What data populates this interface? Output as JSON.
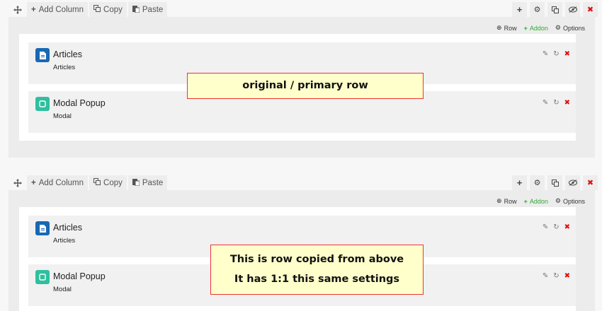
{
  "toolbar": {
    "add_column_label": "Add Column",
    "copy_label": "Copy",
    "paste_label": "Paste"
  },
  "sub_actions": {
    "row_label": "Row",
    "addon_label": "Addon",
    "options_label": "Options"
  },
  "rows": [
    {
      "addons": [
        {
          "title": "Articles",
          "subtitle": "Articles",
          "icon": "article-icon"
        },
        {
          "title": "Modal Popup",
          "subtitle": "Modal",
          "icon": "modal-icon"
        }
      ]
    },
    {
      "addons": [
        {
          "title": "Articles",
          "subtitle": "Articles",
          "icon": "article-icon"
        },
        {
          "title": "Modal Popup",
          "subtitle": "Modal",
          "icon": "modal-icon"
        }
      ]
    }
  ],
  "annotations": {
    "primary": "original / primary row",
    "copied_line1": "This is row copied from above",
    "copied_line2": "It has 1:1 this same settings"
  },
  "colors": {
    "delete": "#dd1111",
    "addon_green": "#33aa33",
    "article_icon_bg": "#1769b4",
    "modal_icon_bg": "#2fbf9f",
    "callout_bg": "#ffffcc",
    "callout_border": "#ee3333"
  }
}
